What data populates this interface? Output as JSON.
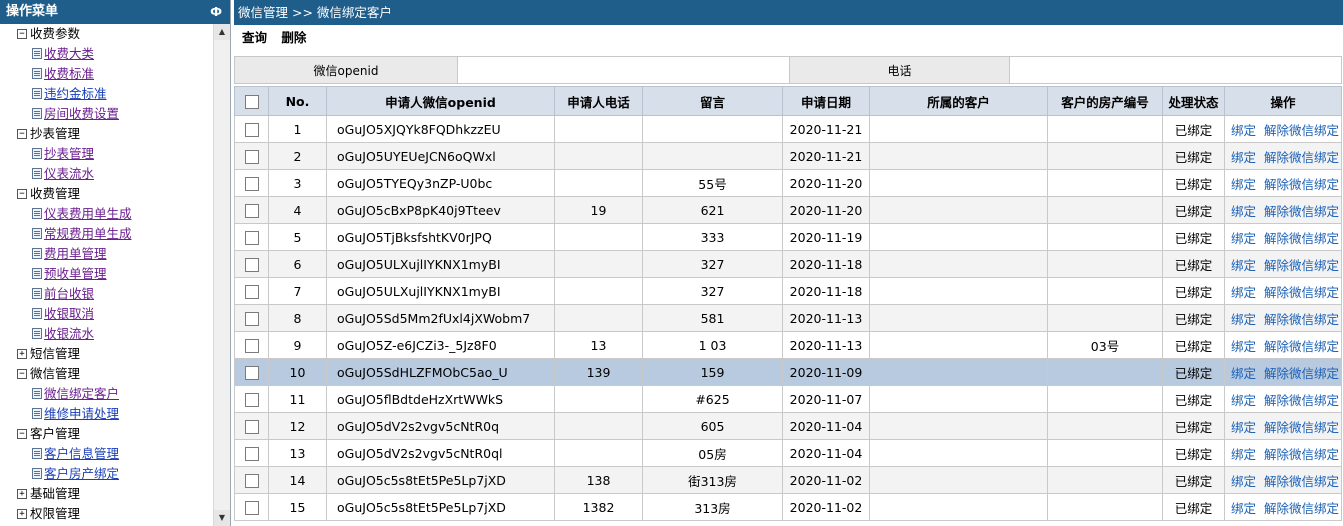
{
  "sidebar": {
    "title": "操作菜单",
    "pin": "Ф",
    "groups": [
      {
        "toggle": "−",
        "label": "收费参数",
        "items": [
          "收费大类",
          "收费标准",
          "违约金标准",
          "房间收费设置"
        ]
      },
      {
        "toggle": "−",
        "label": "抄表管理",
        "items": [
          "抄表管理",
          "仪表流水"
        ]
      },
      {
        "toggle": "−",
        "label": "收费管理",
        "items": [
          "仪表费用单生成",
          "常规费用单生成",
          "费用单管理",
          "预收单管理",
          "前台收银",
          "收银取消",
          "收银流水"
        ]
      },
      {
        "toggle": "+",
        "label": "短信管理",
        "items": []
      },
      {
        "toggle": "−",
        "label": "微信管理",
        "items": [
          "微信绑定客户",
          "维修申请处理"
        ]
      },
      {
        "toggle": "−",
        "label": "客户管理",
        "items": [
          "客户信息管理",
          "客户房产绑定"
        ]
      },
      {
        "toggle": "+",
        "label": "基础管理",
        "items": []
      },
      {
        "toggle": "+",
        "label": "权限管理",
        "items": []
      }
    ]
  },
  "header": {
    "breadcrumb": "微信管理  >> 微信绑定客户"
  },
  "toolbar": {
    "query": "查询",
    "delete": "删除"
  },
  "search": {
    "openid_label": "微信openid",
    "phone_label": "电话",
    "openid_value": "",
    "phone_value": ""
  },
  "grid": {
    "columns": [
      "",
      "No.",
      "申请人微信openid",
      "申请人电话",
      "留言",
      "申请日期",
      "所属的客户",
      "客户的房产编号",
      "处理状态",
      "操作"
    ],
    "bind_action": "绑定",
    "unbind_action": "解除微信绑定",
    "rows": [
      {
        "no": "1",
        "openid": "oGuJO5XJQYk8FQDhkzzEU",
        "phone": "",
        "message": "",
        "date": "2020-11-21",
        "customer": "",
        "property": "",
        "status": "已绑定"
      },
      {
        "no": "2",
        "openid": "oGuJO5UYEUeJCN6oQWxl",
        "phone": "",
        "message": "",
        "date": "2020-11-21",
        "customer": "",
        "property": "",
        "status": "已绑定"
      },
      {
        "no": "3",
        "openid": "oGuJO5TYEQy3nZP-U0bc",
        "phone": "",
        "message": "55号",
        "date": "2020-11-20",
        "customer": "",
        "property": "",
        "status": "已绑定"
      },
      {
        "no": "4",
        "openid": "oGuJO5cBxP8pK40j9Tteev",
        "phone": "19",
        "message": "621",
        "date": "2020-11-20",
        "customer": "",
        "property": "",
        "status": "已绑定"
      },
      {
        "no": "5",
        "openid": "oGuJO5TjBksfshtKV0rJPQ",
        "phone": "",
        "message": "333",
        "date": "2020-11-19",
        "customer": "",
        "property": "",
        "status": "已绑定"
      },
      {
        "no": "6",
        "openid": "oGuJO5ULXujlIYKNX1myBI",
        "phone": "",
        "message": "327",
        "date": "2020-11-18",
        "customer": "",
        "property": "",
        "status": "已绑定"
      },
      {
        "no": "7",
        "openid": "oGuJO5ULXujlIYKNX1myBI",
        "phone": "",
        "message": "327",
        "date": "2020-11-18",
        "customer": "",
        "property": "",
        "status": "已绑定"
      },
      {
        "no": "8",
        "openid": "oGuJO5Sd5Mm2fUxl4jXWobm7",
        "phone": "",
        "message": "581",
        "date": "2020-11-13",
        "customer": "",
        "property": "",
        "status": "已绑定"
      },
      {
        "no": "9",
        "openid": "oGuJO5Z-e6JCZi3-_5Jz8F0",
        "phone": "13",
        "message": "1 03",
        "date": "2020-11-13",
        "customer": "",
        "property": "03号",
        "status": "已绑定"
      },
      {
        "no": "10",
        "openid": "oGuJO5SdHLZFMObC5ao_U",
        "phone": "139",
        "message": "159",
        "date": "2020-11-09",
        "customer": "",
        "property": "",
        "status": "已绑定"
      },
      {
        "no": "11",
        "openid": "oGuJO5flBdtdeHzXrtWWkS",
        "phone": "",
        "message": "#625",
        "date": "2020-11-07",
        "customer": "",
        "property": "",
        "status": "已绑定"
      },
      {
        "no": "12",
        "openid": "oGuJO5dV2s2vgv5cNtR0q",
        "phone": "",
        "message": "605",
        "date": "2020-11-04",
        "customer": "",
        "property": "",
        "status": "已绑定"
      },
      {
        "no": "13",
        "openid": "oGuJO5dV2s2vgv5cNtR0ql",
        "phone": "",
        "message": "05房",
        "date": "2020-11-04",
        "customer": "",
        "property": "",
        "status": "已绑定"
      },
      {
        "no": "14",
        "openid": "oGuJO5c5s8tEt5Pe5Lp7jXD",
        "phone": "138",
        "message": "街313房",
        "date": "2020-11-02",
        "customer": "",
        "property": "",
        "status": "已绑定"
      },
      {
        "no": "15",
        "openid": "oGuJO5c5s8tEt5Pe5Lp7jXD",
        "phone": "1382",
        "message": "313房",
        "date": "2020-11-02",
        "customer": "",
        "property": "",
        "status": "已绑定"
      }
    ]
  }
}
